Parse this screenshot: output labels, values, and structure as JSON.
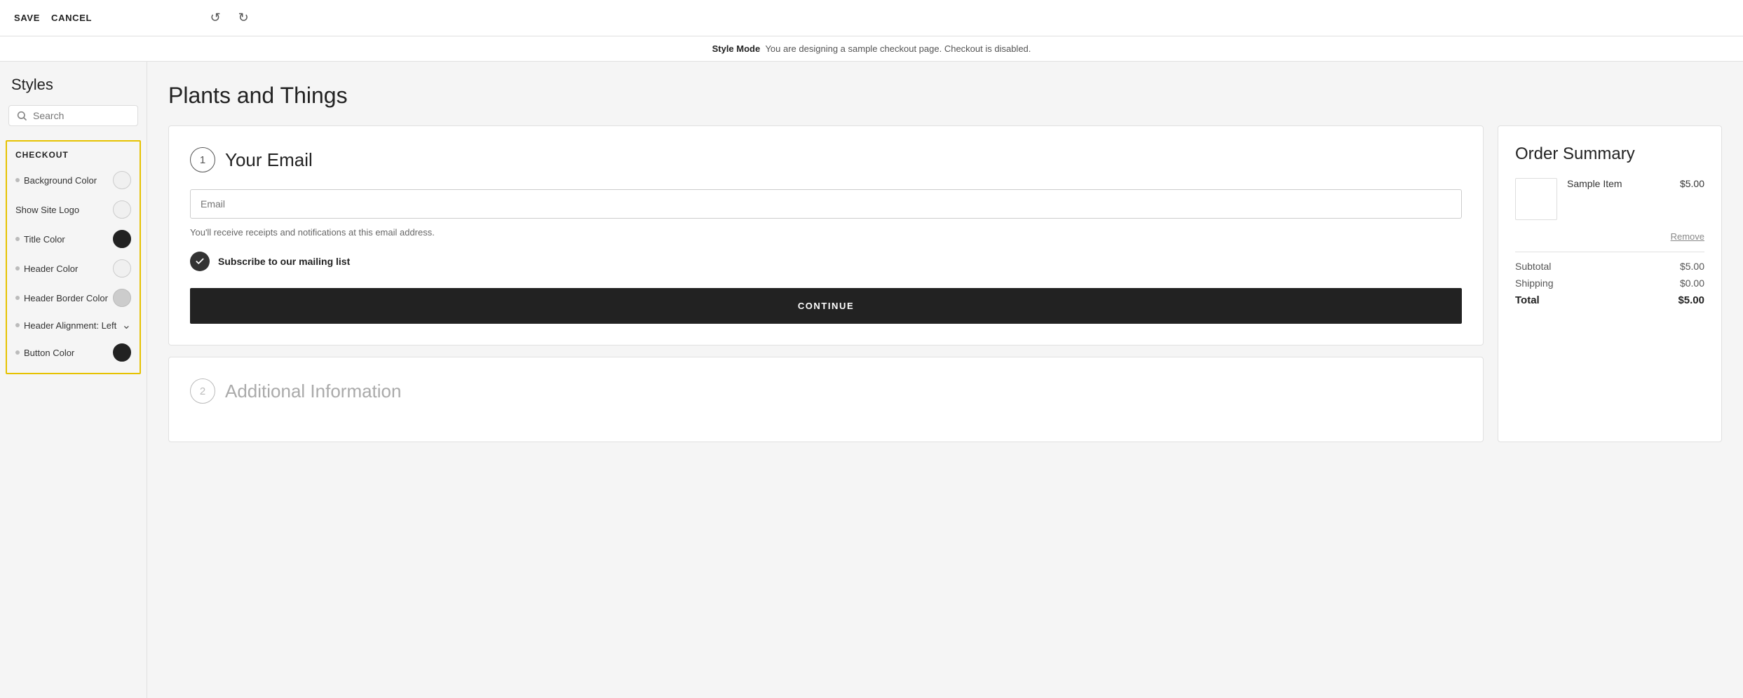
{
  "topbar": {
    "save_label": "SAVE",
    "cancel_label": "CANCEL"
  },
  "style_mode_bar": {
    "prefix": "Style Mode",
    "message": "You are designing a sample checkout page. Checkout is disabled."
  },
  "sidebar": {
    "title": "Styles",
    "search_placeholder": "Search",
    "section_label": "CHECKOUT",
    "items": [
      {
        "label": "Background Color",
        "swatch": "light",
        "has_dot": true
      },
      {
        "label": "Show Site Logo",
        "swatch": "light",
        "has_dot": false
      },
      {
        "label": "Title Color",
        "swatch": "dark",
        "has_dot": true
      },
      {
        "label": "Header Color",
        "swatch": "light",
        "has_dot": true
      },
      {
        "label": "Header Border Color",
        "swatch": "medium",
        "has_dot": true
      },
      {
        "label": "Header Alignment: Left",
        "swatch": null,
        "chevron": true,
        "has_dot": true
      },
      {
        "label": "Button Color",
        "swatch": "dark",
        "has_dot": true
      }
    ]
  },
  "checkout": {
    "page_title": "Plants and Things",
    "step1": {
      "number": "1",
      "title": "Your Email",
      "email_placeholder": "Email",
      "hint": "You'll receive receipts and notifications at this email address.",
      "subscribe_label": "Subscribe to our mailing list",
      "continue_label": "CONTINUE"
    },
    "step2": {
      "number": "2",
      "title": "Additional Information"
    }
  },
  "order_summary": {
    "title": "Order Summary",
    "item_name": "Sample Item",
    "item_price": "$5.00",
    "remove_label": "Remove",
    "subtotal_label": "Subtotal",
    "subtotal_value": "$5.00",
    "shipping_label": "Shipping",
    "shipping_value": "$0.00",
    "total_label": "Total",
    "total_value": "$5.00"
  }
}
